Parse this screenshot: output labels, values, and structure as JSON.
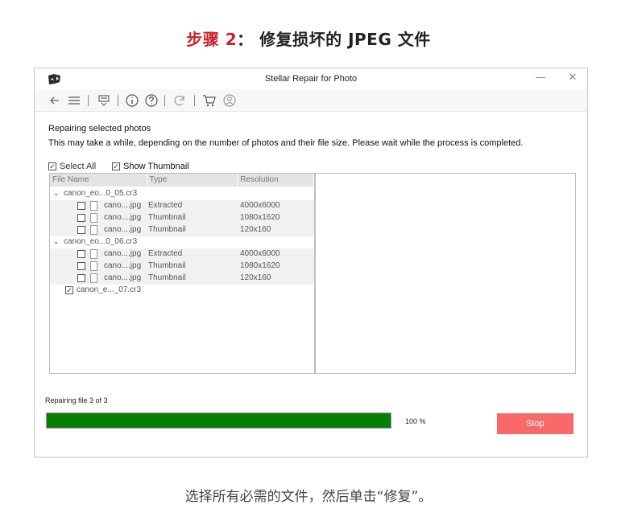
{
  "heading": {
    "step": "步骤 2",
    "sep": "：",
    "title": "修复损坏的 JPEG 文件"
  },
  "window": {
    "title": "Stellar Repair for Photo",
    "min_glyph": "—",
    "close_glyph": "✕"
  },
  "toolbar": {
    "icons": [
      "back-arrow-icon",
      "menu-icon",
      "save-icon",
      "info-icon",
      "help-icon",
      "refresh-icon",
      "cart-icon",
      "user-icon"
    ]
  },
  "main": {
    "heading": "Repairing selected photos",
    "subtext": "This may take a while, depending on the number of photos and their file size. Please wait while the process is completed.",
    "select_all_label": "Select All",
    "show_thumbnail_label": "Show Thumbnail"
  },
  "table": {
    "columns": [
      "File Name",
      "Type",
      "Resolution"
    ],
    "groups": [
      {
        "name": "canon_eo...0_05.cr3",
        "children": [
          {
            "name": "cano....jpg",
            "type": "Extracted",
            "resolution": "4000x6000"
          },
          {
            "name": "cano....jpg",
            "type": "Thumbnail",
            "resolution": "1080x1620"
          },
          {
            "name": "cano....jpg",
            "type": "Thumbnail",
            "resolution": "120x160"
          }
        ]
      },
      {
        "name": "canon_eo...0_06.cr3",
        "children": [
          {
            "name": "cano....jpg",
            "type": "Extracted",
            "resolution": "4000x6000"
          },
          {
            "name": "cano....jpg",
            "type": "Thumbnail",
            "resolution": "1080x1620"
          },
          {
            "name": "cano....jpg",
            "type": "Thumbnail",
            "resolution": "120x160"
          }
        ]
      }
    ],
    "single_item": "canon_e..._07.cr3"
  },
  "progress": {
    "label": "Repairing file 3 of 3",
    "percent_text": "100 %",
    "value": 1.0
  },
  "stop_label": "Stop",
  "caption": "选择所有必需的文件，然后单击“修复”。",
  "colors": {
    "accent_red": "#c8232c",
    "progress_green": "#087e08",
    "stop_button": "#f7696b"
  }
}
